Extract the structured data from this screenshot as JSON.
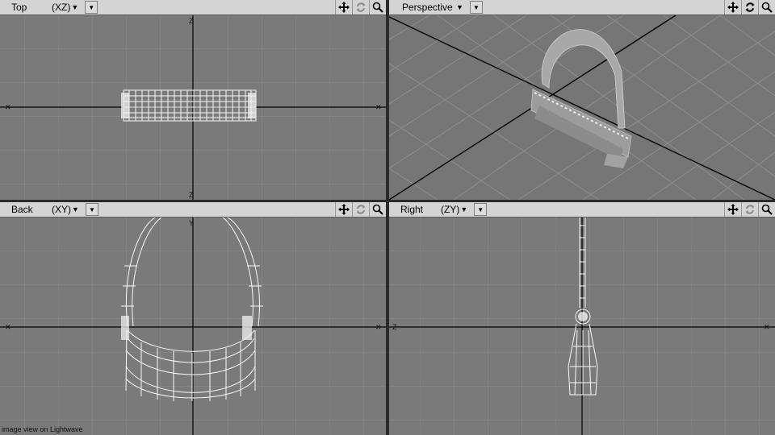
{
  "viewports": {
    "top": {
      "name": "Top",
      "axes": "(XZ)"
    },
    "persp": {
      "name": "Perspective"
    },
    "back": {
      "name": "Back",
      "axes": "(XY)"
    },
    "right": {
      "name": "Right",
      "axes": "(ZY)"
    }
  },
  "axis_labels": {
    "top": {
      "horizontal": "X",
      "vertical": "Z"
    },
    "back": {
      "horizontal": "X",
      "vertical": "Y"
    },
    "right": {
      "horizontal": "Z",
      "vertical": "Y"
    }
  },
  "icons": [
    "move-view-icon",
    "rotate-view-icon",
    "zoom-view-icon",
    "dropdown-arrow-icon",
    "viewport-menu-icon"
  ],
  "caption": "image view on Lightwave"
}
